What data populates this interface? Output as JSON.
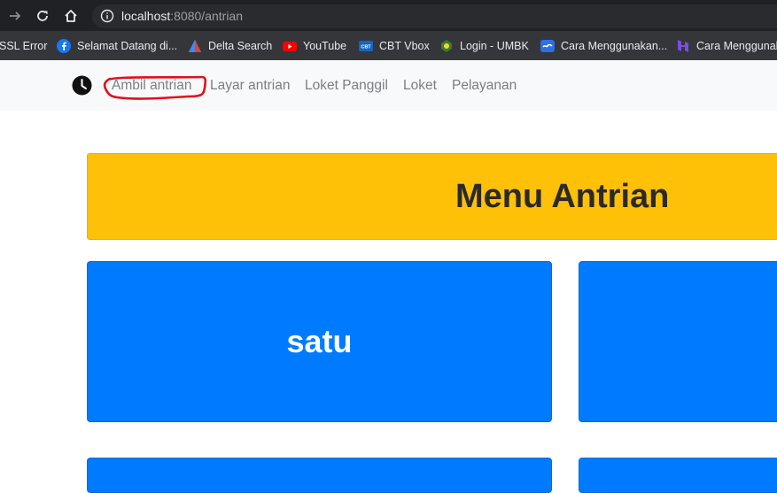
{
  "browser": {
    "url_host": "localhost",
    "url_path": ":8080/antrian",
    "bookmarks": [
      {
        "label": "SSL Error",
        "icon": "none"
      },
      {
        "label": "Selamat Datang di...",
        "icon": "facebook-icon"
      },
      {
        "label": "Delta Search",
        "icon": "delta-icon"
      },
      {
        "label": "YouTube",
        "icon": "youtube-icon"
      },
      {
        "label": "CBT Vbox",
        "icon": "cbt-icon"
      },
      {
        "label": "Login - UMBK",
        "icon": "umbk-icon"
      },
      {
        "label": "Cara Menggunakan...",
        "icon": "link-icon"
      },
      {
        "label": "Cara Menggunak",
        "icon": "hostinger-icon"
      }
    ]
  },
  "navbar": {
    "links": [
      "Ambil antrian",
      "Layar antrian",
      "Loket Panggil",
      "Loket",
      "Pelayanan"
    ]
  },
  "main": {
    "title": "Menu Antrian",
    "cards": [
      "satu",
      "",
      "",
      ""
    ]
  },
  "colors": {
    "banner": "#ffc107",
    "card": "#007bff",
    "annotation": "#e0101e"
  }
}
